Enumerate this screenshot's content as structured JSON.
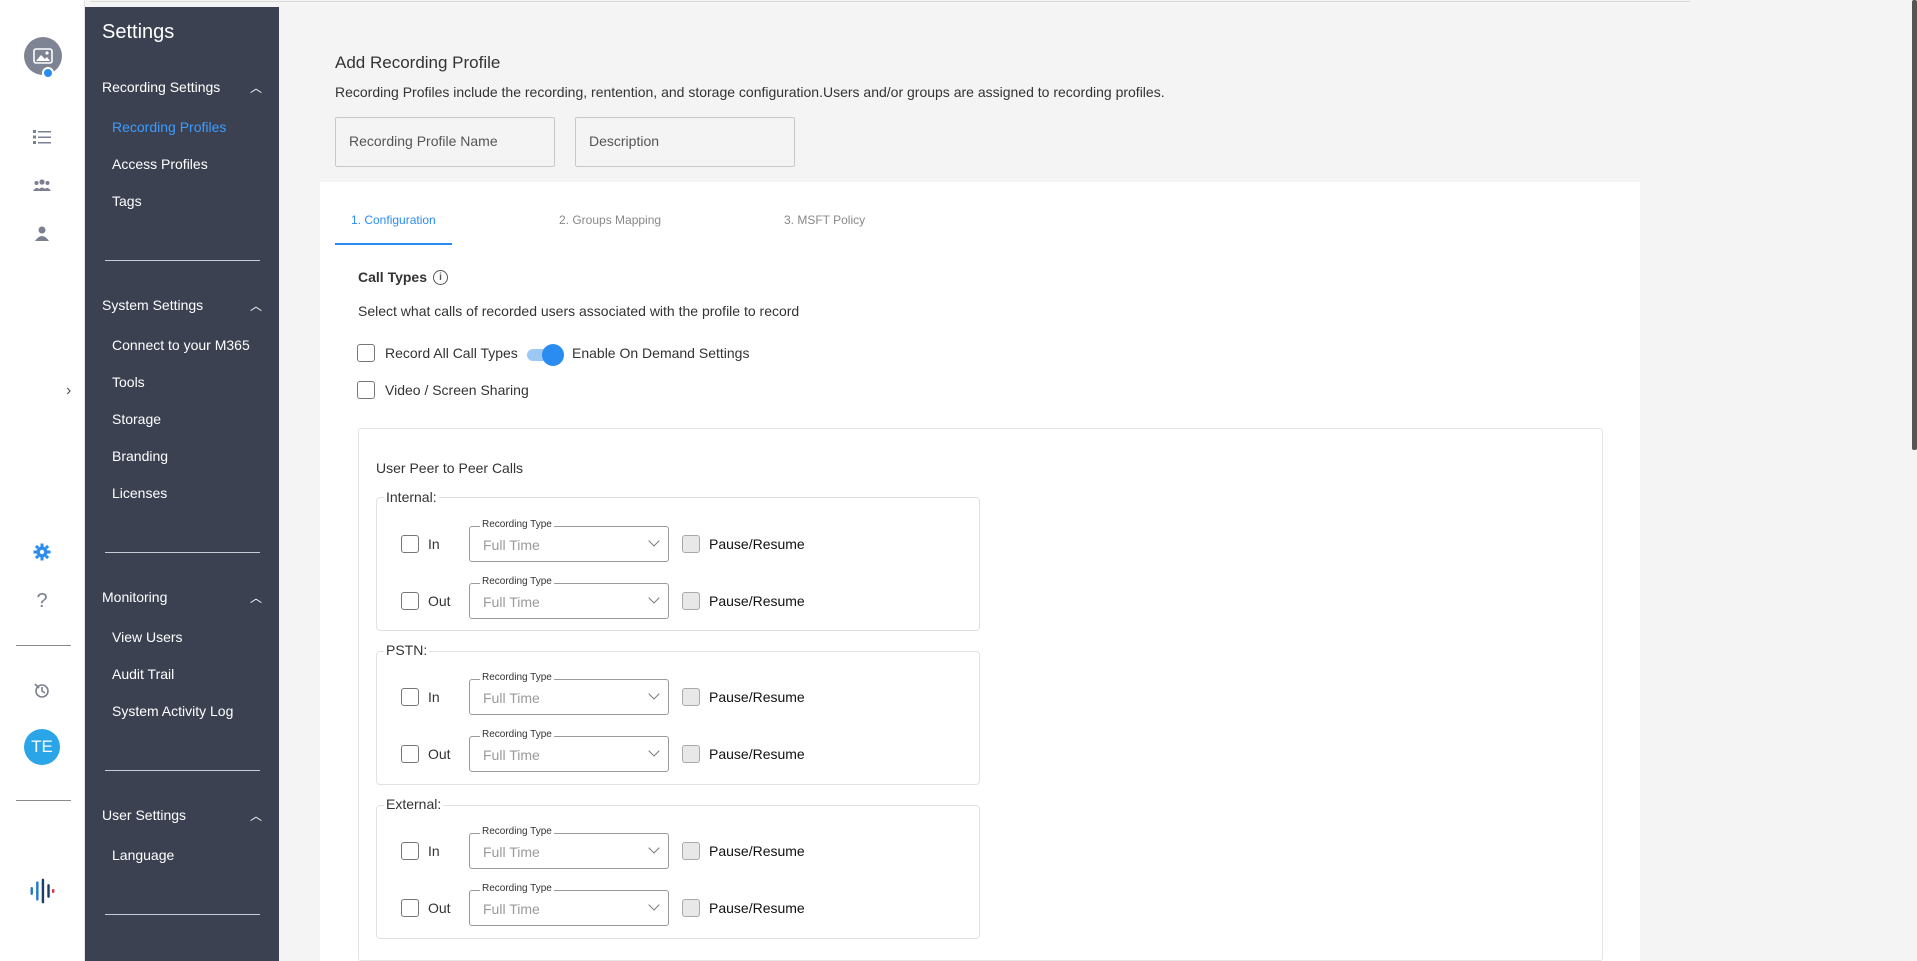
{
  "sidebar": {
    "title": "Settings",
    "groups": [
      {
        "label": "Recording Settings",
        "items": [
          {
            "label": "Recording Profiles"
          },
          {
            "label": "Access Profiles"
          },
          {
            "label": "Tags"
          }
        ]
      },
      {
        "label": "System Settings",
        "items": [
          {
            "label": "Connect to your M365"
          },
          {
            "label": "Tools"
          },
          {
            "label": "Storage"
          },
          {
            "label": "Branding"
          },
          {
            "label": "Licenses"
          }
        ]
      },
      {
        "label": "Monitoring",
        "items": [
          {
            "label": "View Users"
          },
          {
            "label": "Audit Trail"
          },
          {
            "label": "System Activity Log"
          }
        ]
      },
      {
        "label": "User Settings",
        "items": [
          {
            "label": "Language"
          }
        ]
      }
    ]
  },
  "rail": {
    "user_initials": "TE"
  },
  "page": {
    "title": "Add Recording Profile",
    "description": "Recording Profiles include the recording, rentention, and storage configuration.Users and/or groups are assigned to recording profiles.",
    "name_placeholder": "Recording Profile Name",
    "desc_placeholder": "Description"
  },
  "tabs": [
    {
      "label": "1. Configuration",
      "active": true
    },
    {
      "label": "2. Groups Mapping",
      "active": false
    },
    {
      "label": "3. MSFT Policy",
      "active": false
    }
  ],
  "call_types": {
    "title": "Call Types",
    "description": "Select what calls of recorded users associated with the profile to record",
    "record_all_label": "Record All Call Types",
    "on_demand_label": "Enable On Demand Settings",
    "on_demand_enabled": true,
    "video_label": "Video / Screen Sharing"
  },
  "peer_calls": {
    "title": "User Peer to Peer Calls",
    "in_label": "In",
    "out_label": "Out",
    "recording_type_label": "Recording Type",
    "recording_type_value": "Full Time",
    "pause_label": "Pause/Resume",
    "sections": [
      {
        "legend": "Internal:"
      },
      {
        "legend": "PSTN:"
      },
      {
        "legend": "External:"
      }
    ]
  },
  "colors": {
    "sidebar_bg": "#3b4150",
    "accent": "#2a8cf0",
    "avatar_bg": "#2aa6e8"
  }
}
